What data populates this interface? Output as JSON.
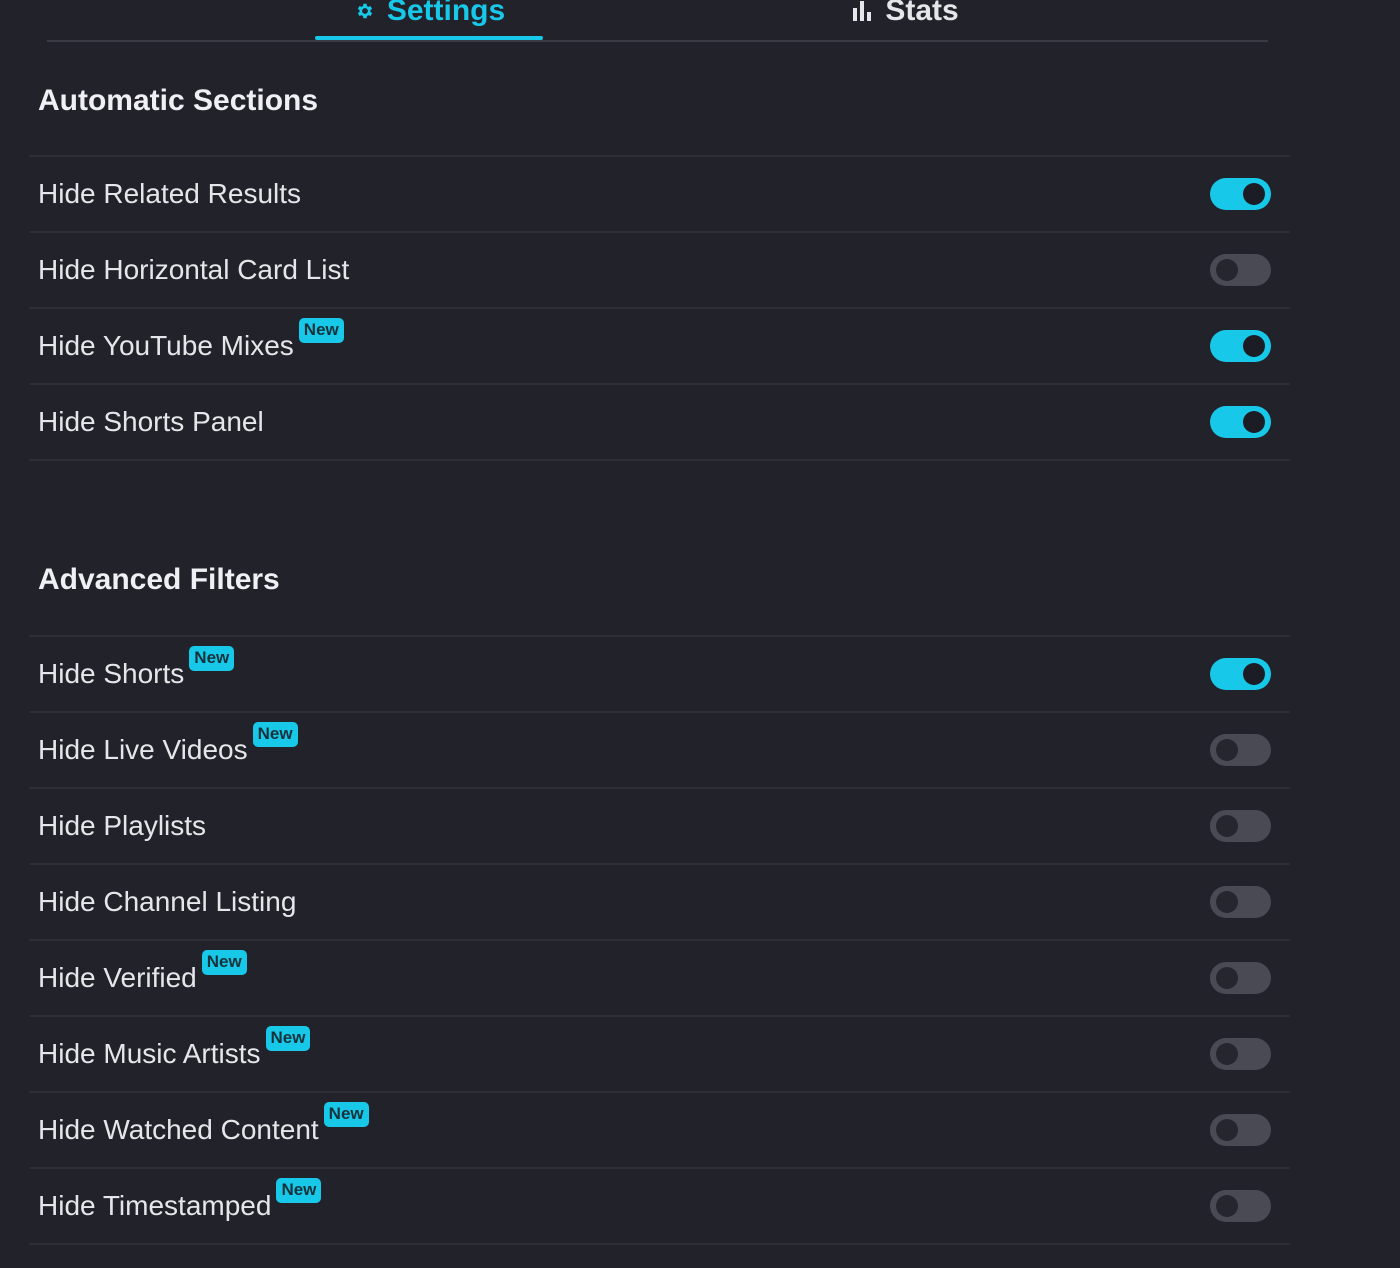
{
  "tabs": {
    "settings_label": "Settings",
    "stats_label": "Stats"
  },
  "automatic": {
    "title": "Automatic Sections",
    "items": [
      {
        "label": "Hide Related Results",
        "new": false,
        "enabled": true
      },
      {
        "label": "Hide Horizontal Card List",
        "new": false,
        "enabled": false
      },
      {
        "label": "Hide YouTube Mixes",
        "new": true,
        "enabled": true
      },
      {
        "label": "Hide Shorts Panel",
        "new": false,
        "enabled": true
      }
    ]
  },
  "advanced": {
    "title": "Advanced Filters",
    "items": [
      {
        "label": "Hide Shorts",
        "new": true,
        "enabled": true
      },
      {
        "label": "Hide Live Videos",
        "new": true,
        "enabled": false
      },
      {
        "label": "Hide Playlists",
        "new": false,
        "enabled": false
      },
      {
        "label": "Hide Channel Listing",
        "new": false,
        "enabled": false
      },
      {
        "label": "Hide Verified",
        "new": true,
        "enabled": false
      },
      {
        "label": "Hide Music Artists",
        "new": true,
        "enabled": false
      },
      {
        "label": "Hide Watched Content",
        "new": true,
        "enabled": false
      },
      {
        "label": "Hide Timestamped",
        "new": true,
        "enabled": false
      }
    ]
  },
  "badge_label": "New",
  "colors": {
    "background": "#22222a",
    "accent": "#18c8e8",
    "toggle_off": "#4a4a54",
    "divider": "#2e2e37"
  },
  "icons": {
    "settings_tab": "gear-icon",
    "stats_tab": "bar-chart-icon"
  }
}
